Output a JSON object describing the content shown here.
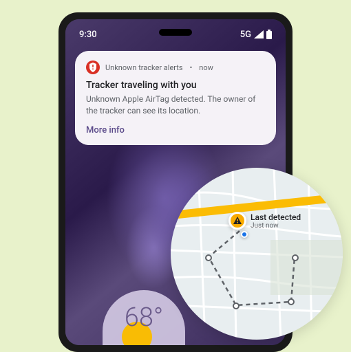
{
  "status_bar": {
    "time": "9:30",
    "network": "5G"
  },
  "notification": {
    "app_name": "Unknown tracker alerts",
    "timestamp": "now",
    "title": "Tracker traveling with you",
    "body": "Unknown Apple AirTag detected. The owner of the tracker can see its location.",
    "action": "More info"
  },
  "weather": {
    "temperature": "68°"
  },
  "map": {
    "marker_title": "Last detected",
    "marker_subtitle": "Just now"
  }
}
